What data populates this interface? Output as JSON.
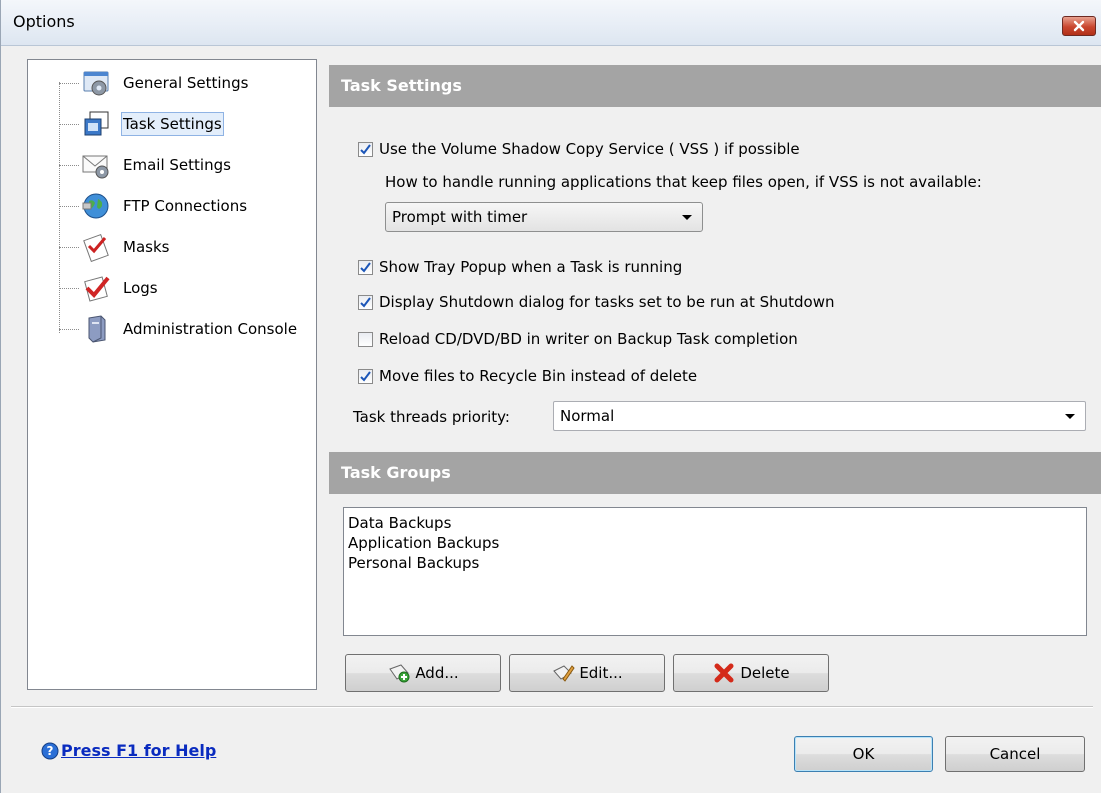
{
  "window": {
    "title": "Options"
  },
  "tree": {
    "items": [
      {
        "label": "General Settings",
        "icon": "gear-window-icon"
      },
      {
        "label": "Task Settings",
        "icon": "task-window-icon",
        "selected": true
      },
      {
        "label": "Email Settings",
        "icon": "envelope-gear-icon"
      },
      {
        "label": "FTP Connections",
        "icon": "globe-icon"
      },
      {
        "label": "Masks",
        "icon": "mask-check-icon"
      },
      {
        "label": "Logs",
        "icon": "log-check-icon"
      },
      {
        "label": "Administration Console",
        "icon": "server-icon"
      }
    ]
  },
  "task_settings": {
    "header": "Task Settings",
    "vss": {
      "label": "Use the Volume Shadow Copy Service ( VSS ) if possible",
      "checked": true
    },
    "open_files_label": "How to handle running applications that keep files open, if VSS is not available:",
    "open_files_value": "Prompt with timer",
    "tray": {
      "label": "Show Tray Popup when a Task is running",
      "checked": true
    },
    "shutdown": {
      "label": "Display Shutdown dialog for tasks set to be run at Shutdown",
      "checked": true
    },
    "reload": {
      "label": "Reload CD/DVD/BD in writer on Backup Task completion",
      "checked": false
    },
    "recycle": {
      "label": "Move files to Recycle Bin instead of delete",
      "checked": true
    },
    "priority_label": "Task threads priority:",
    "priority_value": "Normal"
  },
  "task_groups": {
    "header": "Task Groups",
    "items": [
      "Data Backups",
      "Application Backups",
      "Personal Backups"
    ],
    "add_label": "Add...",
    "edit_label": "Edit...",
    "delete_label": "Delete"
  },
  "footer": {
    "help_label": "Press F1 for Help",
    "ok_label": "OK",
    "cancel_label": "Cancel"
  },
  "colors": {
    "header_bg": "#a4a4a4",
    "link": "#0a2bbf",
    "check": "#1c56b8",
    "selection": "#e3eefb"
  }
}
